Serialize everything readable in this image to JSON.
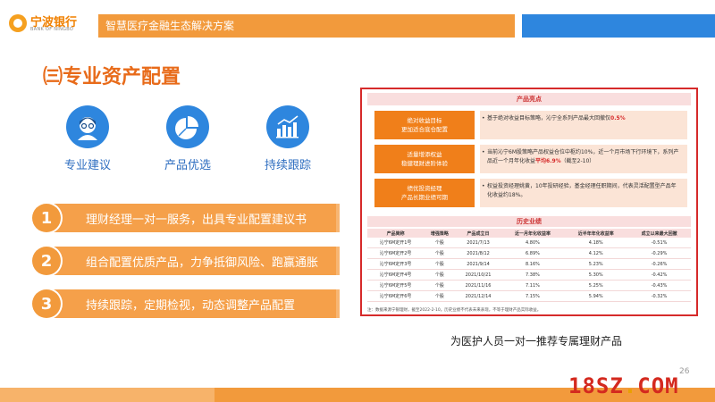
{
  "brand": {
    "name_cn": "宁波银行",
    "name_en": "BANK OF NINGBO"
  },
  "header": {
    "title": "智慧医疗金融生态解决方案"
  },
  "section": {
    "title": "㈢专业资产配置"
  },
  "features": [
    {
      "label": "专业建议",
      "icon": "advisor-icon"
    },
    {
      "label": "产品优选",
      "icon": "pie-chart-icon"
    },
    {
      "label": "持续跟踪",
      "icon": "bar-chart-icon"
    }
  ],
  "items": [
    {
      "num": "1",
      "text": "理财经理一对一服务，出具专业配置建议书"
    },
    {
      "num": "2",
      "text": "组合配置优质产品，力争抵御风险、跑赢通胀"
    },
    {
      "num": "3",
      "text": "持续跟踪，定期检视，动态调整产品配置"
    }
  ],
  "panel": {
    "highlights_title": "产品亮点",
    "highlights": [
      {
        "left1": "绝对收益目标",
        "left2": "更加适合底仓配置",
        "right_a": "基于绝对收益目标策略，沁宁全系列产品最大回撤仅",
        "right_hl": "0.5%",
        "right_b": ""
      },
      {
        "left1": "适量增添权益",
        "left2": "稳健理财进阶体验",
        "right_a": "当前沁宁6M股策略产品权益仓位中枢约10%，近一个月市场下行环境下，系列产品近一个月年化收益",
        "right_hl": "平均6.9%",
        "right_b": "（截至2-10）"
      },
      {
        "left1": "绩优投资经理",
        "left2": "产品长期业绩可期",
        "right_a": "权益投资经理姚黄，10年投研经验，基金经理任职期间，代表灵活配置型产品年化收益约18%。",
        "right_hl": "",
        "right_b": ""
      }
    ],
    "history_title": "历史业绩",
    "table": {
      "headers": [
        "产品简称",
        "增强策略",
        "产品成立日",
        "近一月年化收益率",
        "近半年年化收益率",
        "成立以来最大回撤"
      ],
      "rows": [
        [
          "沁宁6M定开1号",
          "个股",
          "2021/7/13",
          "4.80%",
          "4.18%",
          "-0.51%"
        ],
        [
          "沁宁6M定开2号",
          "个股",
          "2021/8/12",
          "6.89%",
          "4.12%",
          "-0.29%"
        ],
        [
          "沁宁6M定开3号",
          "个股",
          "2021/9/14",
          "8.16%",
          "5.23%",
          "-0.26%"
        ],
        [
          "沁宁6M定开4号",
          "个股",
          "2021/10/21",
          "7.38%",
          "5.30%",
          "-0.42%"
        ],
        [
          "沁宁6M定开5号",
          "个股",
          "2021/11/16",
          "7.11%",
          "5.25%",
          "-0.43%"
        ],
        [
          "沁宁6M定开6号",
          "个股",
          "2021/12/14",
          "7.15%",
          "5.94%",
          "-0.32%"
        ]
      ]
    },
    "note": "注：数据来源宁银理财，截至2022-2-10。历史业绩不代表未来表现，不等于理财产品实际收益。"
  },
  "caption": "为医护人员一对一推荐专属理财产品",
  "page_number": "26",
  "watermark": {
    "a": "18SZ",
    "dot": ".",
    "b": "COM"
  }
}
